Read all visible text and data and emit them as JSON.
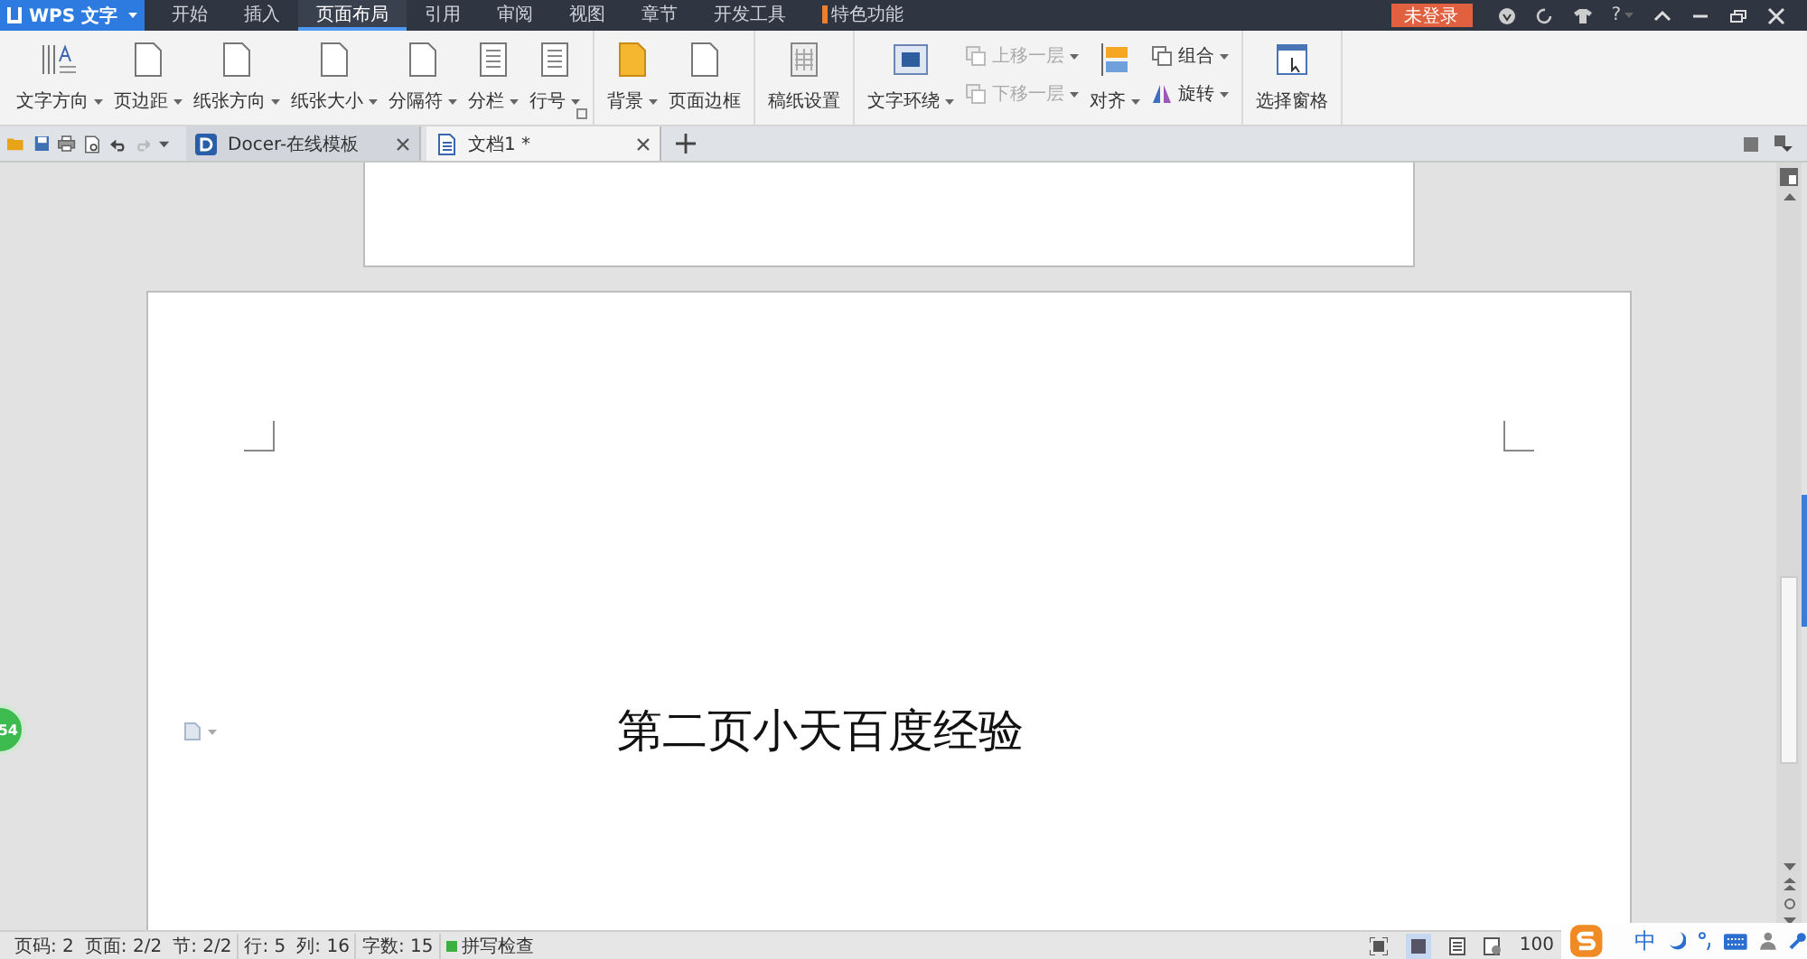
{
  "title_bar": {
    "app_button": "WPS 文字",
    "menu_tabs": [
      {
        "label": "开始",
        "selected": false,
        "kind": "plain"
      },
      {
        "label": "插入",
        "selected": false,
        "kind": "plain"
      },
      {
        "label": "页面布局",
        "selected": true,
        "kind": "plain"
      },
      {
        "label": "引用",
        "selected": false,
        "kind": "plain"
      },
      {
        "label": "审阅",
        "selected": false,
        "kind": "plain"
      },
      {
        "label": "视图",
        "selected": false,
        "kind": "plain"
      },
      {
        "label": "章节",
        "selected": false,
        "kind": "plain"
      },
      {
        "label": "开发工具",
        "selected": false,
        "kind": "plain"
      },
      {
        "label": "特色功能",
        "selected": false,
        "kind": "special"
      }
    ],
    "login_button": "未登录",
    "help_button": "?"
  },
  "ribbon": {
    "groups": [
      {
        "launcher": true,
        "items": [
          {
            "kind": "large",
            "label": "文字方向",
            "dropdown": true,
            "disabled": false
          },
          {
            "kind": "large",
            "label": "页边距",
            "dropdown": true,
            "disabled": false
          },
          {
            "kind": "large",
            "label": "纸张方向",
            "dropdown": true,
            "disabled": false
          },
          {
            "kind": "large",
            "label": "纸张大小",
            "dropdown": true,
            "disabled": false
          },
          {
            "kind": "large",
            "label": "分隔符",
            "dropdown": true,
            "disabled": false
          },
          {
            "kind": "large",
            "label": "分栏",
            "dropdown": true,
            "disabled": false
          },
          {
            "kind": "large",
            "label": "行号",
            "dropdown": true,
            "disabled": false
          }
        ]
      },
      {
        "items": [
          {
            "kind": "large",
            "label": "背景",
            "dropdown": true,
            "disabled": false
          },
          {
            "kind": "large",
            "label": "页面边框",
            "dropdown": false,
            "disabled": false
          }
        ]
      },
      {
        "items": [
          {
            "kind": "large",
            "label": "稿纸设置",
            "dropdown": false,
            "disabled": false
          }
        ]
      },
      {
        "items": [
          {
            "kind": "large",
            "label": "文字环绕",
            "dropdown": true,
            "disabled": false
          },
          {
            "kind": "stack",
            "items": [
              {
                "label": "上移一层",
                "dropdown": true,
                "disabled": true
              },
              {
                "label": "下移一层",
                "dropdown": true,
                "disabled": true
              }
            ]
          },
          {
            "kind": "large",
            "label": "对齐",
            "dropdown": true,
            "disabled": false
          },
          {
            "kind": "stack",
            "items": [
              {
                "label": "组合",
                "dropdown": true,
                "disabled": false
              },
              {
                "label": "旋转",
                "dropdown": true,
                "disabled": false
              }
            ]
          }
        ]
      },
      {
        "items": [
          {
            "kind": "large",
            "label": "选择窗格",
            "dropdown": false,
            "disabled": false
          }
        ]
      }
    ]
  },
  "doc_tabs": [
    {
      "label": "Docer-在线模板",
      "selected": false
    },
    {
      "label": "文档1 *",
      "selected": true
    }
  ],
  "document": {
    "page_text": "第二页小天百度经验"
  },
  "floating_ball": "54",
  "status_bar": {
    "items": [
      {
        "kind": "text",
        "label": "页码: 2"
      },
      {
        "kind": "text",
        "label": "页面: 2/2"
      },
      {
        "kind": "text",
        "label": "节: 2/2"
      },
      {
        "kind": "text",
        "label": "行: 5"
      },
      {
        "kind": "text",
        "label": "列: 16"
      },
      {
        "kind": "text",
        "label": "字数: 15"
      },
      {
        "kind": "check",
        "label": "拼写检查",
        "on": true
      }
    ],
    "zoom": "100"
  },
  "ime_bar": {
    "mode": "中"
  }
}
